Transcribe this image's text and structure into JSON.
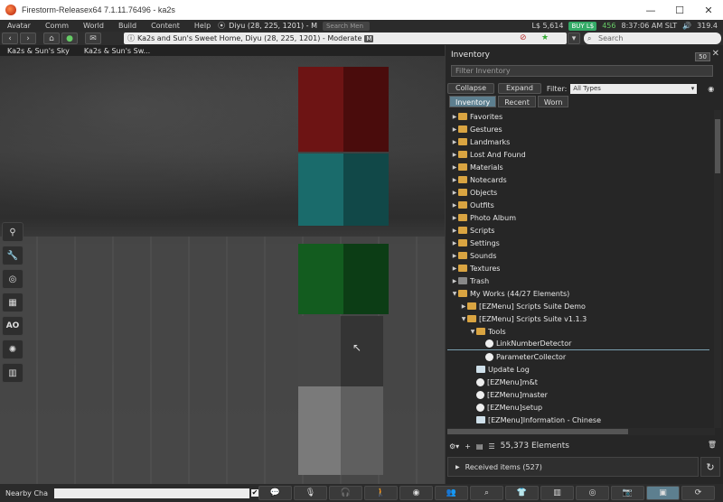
{
  "window": {
    "title": "Firestorm-Releasex64 7.1.11.76496 - ka2s",
    "minimize": "—",
    "maximize": "☐",
    "close": "✕"
  },
  "menubar": {
    "items": [
      "Avatar",
      "Comm",
      "World",
      "Build",
      "Content",
      "Help"
    ],
    "location": "Diyu (28, 225, 1201) - M",
    "search_placeholder": "Search Men",
    "balance": "L$ 5,614",
    "buy_label": "BUY L$",
    "count": "456",
    "time": "8:37:06 AM SLT",
    "fps": "319.4"
  },
  "navbar": {
    "address": "Ka2s and Sun's Sweet Home, Diyu (28, 225, 1201) - Moderate",
    "rating_badge": "M",
    "search_placeholder": "Search"
  },
  "favorites": [
    "Ka2s & Sun's Sky",
    "Ka2s & Sun's Sw..."
  ],
  "left_toolbar": [
    "map-pin",
    "wrench",
    "camera",
    "map",
    "AO",
    "sun",
    "store"
  ],
  "inventory": {
    "title": "Inventory",
    "badge": "50",
    "filter_placeholder": "Filter Inventory",
    "collapse_label": "Collapse",
    "expand_label": "Expand",
    "filter_label": "Filter:",
    "filter_value": "All Types",
    "tabs": [
      "Inventory",
      "Recent",
      "Worn"
    ],
    "tree": [
      {
        "label": "Favorites",
        "indent": 0,
        "arrow": "▶",
        "icon": "folder"
      },
      {
        "label": "Gestures",
        "indent": 0,
        "arrow": "▶",
        "icon": "folder"
      },
      {
        "label": "Landmarks",
        "indent": 0,
        "arrow": "▶",
        "icon": "folder"
      },
      {
        "label": "Lost And Found",
        "indent": 0,
        "arrow": "▶",
        "icon": "folder"
      },
      {
        "label": "Materials",
        "indent": 0,
        "arrow": "▶",
        "icon": "folder"
      },
      {
        "label": "Notecards",
        "indent": 0,
        "arrow": "▶",
        "icon": "folder"
      },
      {
        "label": "Objects",
        "indent": 0,
        "arrow": "▶",
        "icon": "folder"
      },
      {
        "label": "Outfits",
        "indent": 0,
        "arrow": "▶",
        "icon": "folder"
      },
      {
        "label": "Photo Album",
        "indent": 0,
        "arrow": "▶",
        "icon": "folder"
      },
      {
        "label": "Scripts",
        "indent": 0,
        "arrow": "▶",
        "icon": "folder"
      },
      {
        "label": "Settings",
        "indent": 0,
        "arrow": "▶",
        "icon": "folder"
      },
      {
        "label": "Sounds",
        "indent": 0,
        "arrow": "▶",
        "icon": "folder"
      },
      {
        "label": "Textures",
        "indent": 0,
        "arrow": "▶",
        "icon": "folder"
      },
      {
        "label": "Trash",
        "indent": 0,
        "arrow": "▶",
        "icon": "trash"
      },
      {
        "label": "My Works (44/27 Elements)",
        "indent": 0,
        "arrow": "▼",
        "icon": "folder"
      },
      {
        "label": "[EZMenu] Scripts Suite Demo",
        "indent": 1,
        "arrow": "▶",
        "icon": "folder"
      },
      {
        "label": "[EZMenu] Scripts Suite v1.1.3",
        "indent": 1,
        "arrow": "▼",
        "icon": "folder"
      },
      {
        "label": "Tools",
        "indent": 2,
        "arrow": "▼",
        "icon": "folder"
      },
      {
        "label": "LinkNumberDetector",
        "indent": 3,
        "arrow": "",
        "icon": "script",
        "selected": true
      },
      {
        "label": "ParameterCollector",
        "indent": 3,
        "arrow": "",
        "icon": "script"
      },
      {
        "label": "Update Log",
        "indent": 2,
        "arrow": "",
        "icon": "note"
      },
      {
        "label": "[EZMenu]m&t",
        "indent": 2,
        "arrow": "",
        "icon": "script"
      },
      {
        "label": "[EZMenu]master",
        "indent": 2,
        "arrow": "",
        "icon": "script"
      },
      {
        "label": "[EZMenu]setup",
        "indent": 2,
        "arrow": "",
        "icon": "script"
      },
      {
        "label": "[EZMenu]Information - Chinese",
        "indent": 2,
        "arrow": "",
        "icon": "note"
      }
    ],
    "elements": "55,373 Elements",
    "received": "Received items (527)"
  },
  "bottombar": {
    "nearby_label": "Nearby Cha",
    "buttons": [
      "speech",
      "mic",
      "headphones",
      "walk",
      "eye",
      "people",
      "search",
      "shirt",
      "bars",
      "target",
      "camera",
      "inventory",
      "refresh"
    ]
  },
  "scene": {
    "cubes": [
      {
        "color": "#6d1414",
        "side": "#4a0c0c"
      },
      {
        "color": "#1a6b6b",
        "side": "#114848"
      },
      {
        "color": "#135c1f",
        "side": "#0c3d15"
      },
      {
        "color": "#474747",
        "side": "#343434"
      },
      {
        "color": "#7a7a7a",
        "side": "#5f5f5f"
      }
    ]
  }
}
